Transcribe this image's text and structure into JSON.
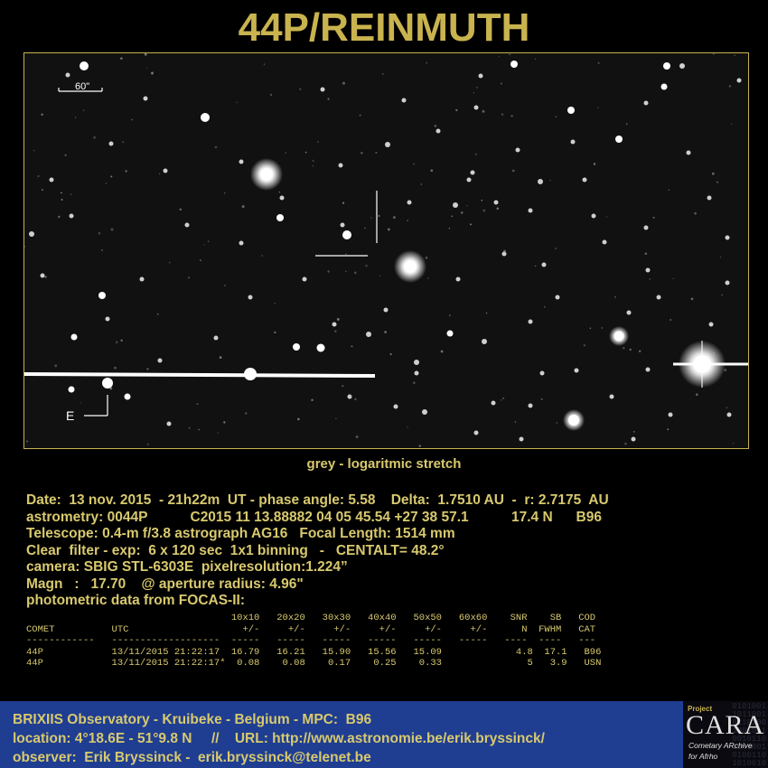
{
  "title": "44P/REINMUTH",
  "image": {
    "scale_label": "60\"",
    "direction_label": "E"
  },
  "caption": "grey - logaritmic stretch",
  "info": {
    "line1": "Date:  13 nov. 2015  - 21h22m  UT - phase angle: 5.58    Delta:  1.7510 AU  -  r: 2.7175  AU",
    "line2": "astrometry: 0044P           C2015 11 13.88882 04 05 45.54 +27 38 57.1           17.4 N      B96",
    "line3": "Telescope: 0.4-m f/3.8 astrograph AG16   Focal Length: 1514 mm",
    "line4": "Clear  filter - exp:  6 x 120 sec  1x1 binning   -   CENTALT= 48.2°",
    "line5": "camera: SBIG STL-6303E  pixelresolution:1.224”",
    "line6": "Magn   :   17.70    @ aperture radius: 4.96\"",
    "line7": "photometric data from FOCAS-II:"
  },
  "photometry": {
    "header1": "                                    10x10   20x20   30x30   40x40   50x50   60x60    SNR    SB   COD",
    "header2": "COMET          UTC                    +/-     +/-     +/-     +/-     +/-     +/-      N  FWHM   CAT",
    "separator": "------------   -------------------  -----   -----   -----   -----   -----   -----   ----  ----   ---",
    "row1": "44P            13/11/2015 21:22:17  16.79   16.21   15.90   15.56   15.09             4.8  17.1   B96",
    "row2": "44P            13/11/2015 21:22:17*  0.08    0.08    0.17    0.25    0.33               5   3.9   USN"
  },
  "footer": {
    "line1": "BRIXIIS Observatory - Kruibeke - Belgium - MPC:  B96",
    "line2": "location: 4°18.6E - 51°9.8 N     //    URL: http://www.astronomie.be/erik.bryssinck/",
    "line3": "observer:  Erik Bryssinck -  erik.bryssinck@telenet.be"
  },
  "logo": {
    "project": "Project",
    "name": "CARA",
    "subtitle1": "Cometary ARchive",
    "subtitle2": "for Afrho"
  },
  "colors": {
    "title": "#c9b34f",
    "text": "#d8c96e",
    "footer_bg": "#1f3e92"
  }
}
